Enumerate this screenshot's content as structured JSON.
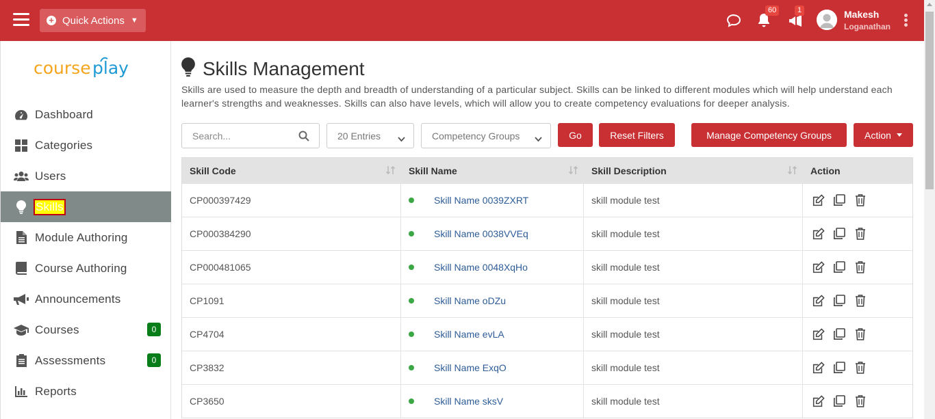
{
  "header": {
    "quick_actions_label": "Quick Actions",
    "notification_count": "60",
    "announcement_count": "1",
    "user_first": "Makesh",
    "user_last": "Loganathan"
  },
  "colors": {
    "brand_red": "#c93034",
    "sidebar_active": "#7f8a89",
    "badge_green": "#0a7d1b",
    "status_green": "#3ca845",
    "link_blue": "#2d5c97"
  },
  "logo": {
    "part1": "course",
    "part2": "play"
  },
  "sidebar": {
    "items": [
      {
        "label": "Dashboard",
        "icon": "dashboard-icon"
      },
      {
        "label": "Categories",
        "icon": "grid-icon"
      },
      {
        "label": "Users",
        "icon": "users-icon"
      },
      {
        "label": "Skills",
        "icon": "lightbulb-icon",
        "active": true
      },
      {
        "label": "Module Authoring",
        "icon": "file-icon"
      },
      {
        "label": "Course Authoring",
        "icon": "book-icon"
      },
      {
        "label": "Announcements",
        "icon": "megaphone-icon"
      },
      {
        "label": "Courses",
        "icon": "graduation-cap-icon",
        "count": "0"
      },
      {
        "label": "Assessments",
        "icon": "clipboard-icon",
        "count": "0"
      },
      {
        "label": "Reports",
        "icon": "bar-chart-icon"
      }
    ]
  },
  "page": {
    "title": "Skills Management",
    "description": "Skills are used to measure the depth and breadth of understanding of a particular subject. Skills can be linked to different modules which will help understand each learner's strengths and weaknesses. Skills can also have levels, which will allow you to create competency evaluations for deeper analysis."
  },
  "toolbar": {
    "search_placeholder": "Search...",
    "entries_value": "20 Entries",
    "competency_value": "Competency Groups",
    "go_label": "Go",
    "reset_label": "Reset Filters",
    "manage_label": "Manage Competency Groups",
    "action_label": "Action"
  },
  "table": {
    "headers": [
      "Skill Code",
      "Skill Name",
      "Skill Description",
      "Action"
    ],
    "rows": [
      {
        "code": "CP000397429",
        "name": "Skill Name 0039ZXRT",
        "desc": "skill module test"
      },
      {
        "code": "CP000384290",
        "name": "Skill Name 0038VVEq",
        "desc": "skill module test"
      },
      {
        "code": "CP000481065",
        "name": "Skill Name 0048XqHo",
        "desc": "skill module test"
      },
      {
        "code": "CP1091",
        "name": "Skill Name oDZu",
        "desc": "skill module test"
      },
      {
        "code": "CP4704",
        "name": "Skill Name evLA",
        "desc": "skill module test"
      },
      {
        "code": "CP3832",
        "name": "Skill Name ExqO",
        "desc": "skill module test"
      },
      {
        "code": "CP3650",
        "name": "Skill Name sksV",
        "desc": "skill module test"
      }
    ]
  }
}
